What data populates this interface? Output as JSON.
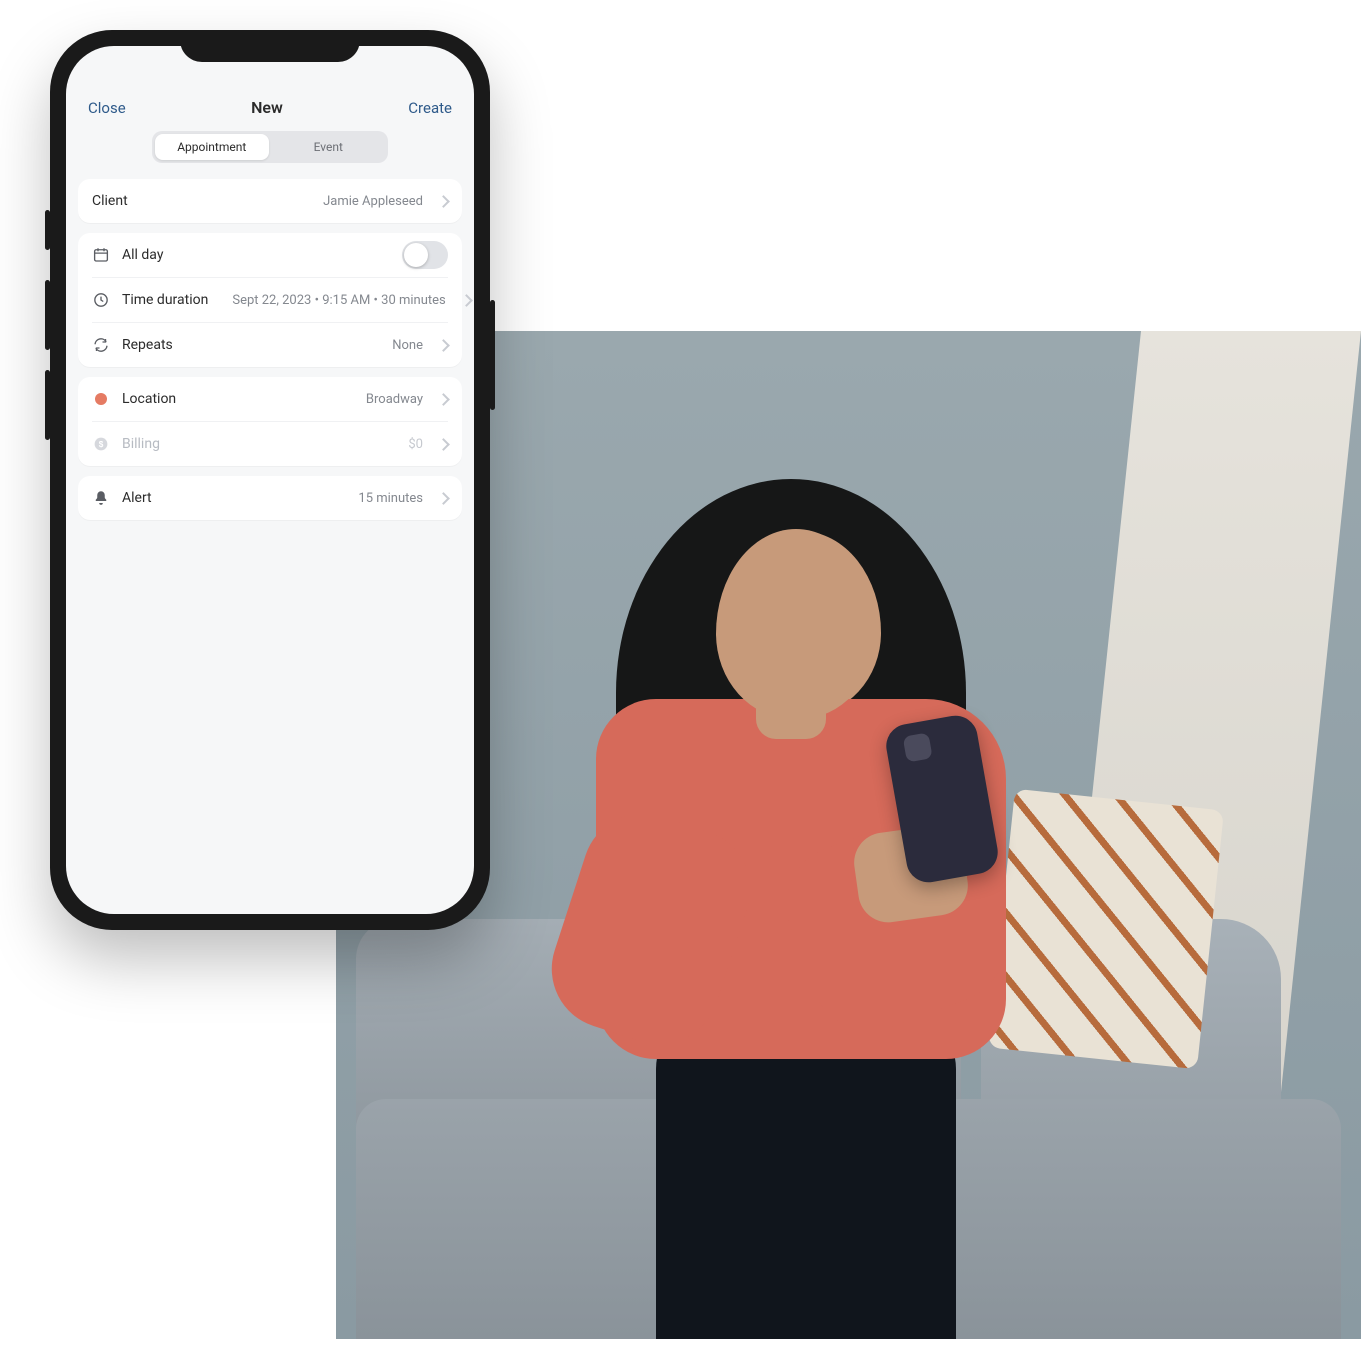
{
  "nav": {
    "close": "Close",
    "title": "New",
    "create": "Create"
  },
  "tabs": {
    "appointment": "Appointment",
    "event": "Event"
  },
  "client": {
    "label": "Client",
    "value": "Jamie Appleseed"
  },
  "allday": {
    "label": "All day",
    "on": false
  },
  "duration": {
    "label": "Time duration",
    "value": "Sept 22, 2023  •  9:15 AM  •  30 minutes"
  },
  "repeats": {
    "label": "Repeats",
    "value": "None"
  },
  "location": {
    "label": "Location",
    "value": "Broadway"
  },
  "billing": {
    "label": "Billing",
    "value": "$0"
  },
  "alert": {
    "label": "Alert",
    "value": "15 minutes"
  }
}
